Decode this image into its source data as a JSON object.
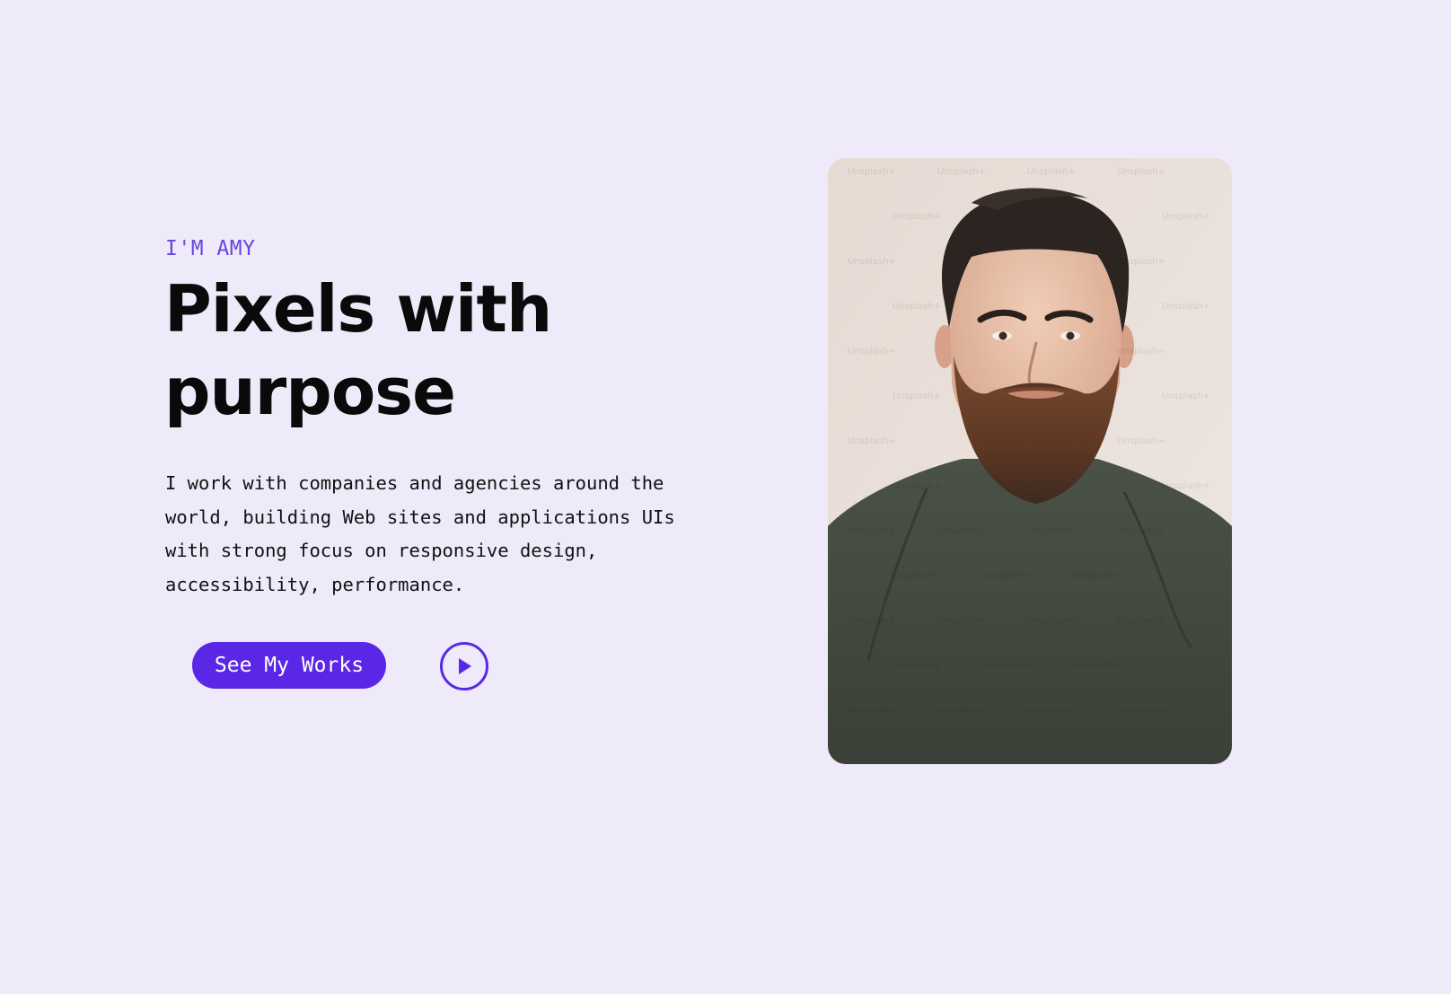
{
  "hero": {
    "eyebrow": "I'M AMY",
    "headline": "Pixels with purpose",
    "description": "I work with companies and agencies around the world, building Web sites and applications UIs with strong focus on responsive design, accessibility, performance.",
    "cta_label": "See My Works",
    "play_icon": "play-icon"
  },
  "portrait": {
    "watermark": "Unsplash+",
    "subject": "portrait-photo"
  },
  "colors": {
    "background": "#efeafa",
    "accent": "#5b27e6",
    "eyebrow": "#6b45e0",
    "text": "#0a0a0a"
  }
}
